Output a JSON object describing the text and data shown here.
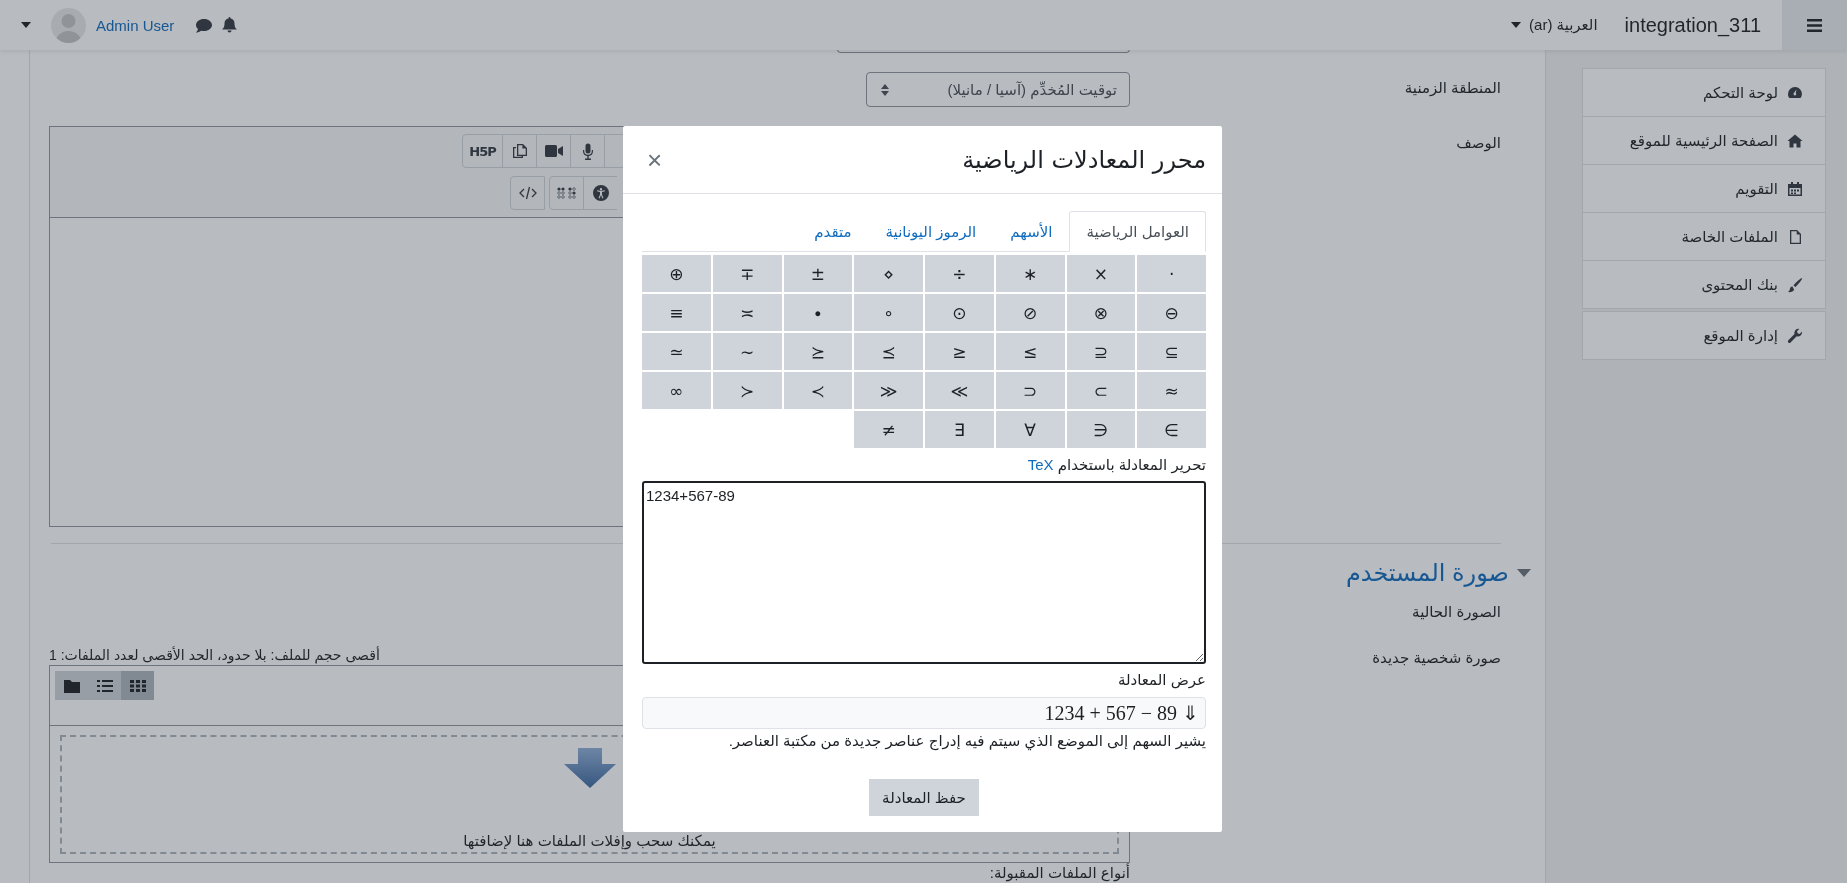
{
  "navbar": {
    "user_name": "Admin User",
    "language": "العربية (ar)",
    "site_name": "integration_311"
  },
  "sidebar": {
    "groups": [
      {
        "items": [
          {
            "label": "لوحة التحكم"
          },
          {
            "label": "الصفحة الرئيسية للموقع"
          },
          {
            "label": "التقويم"
          },
          {
            "label": "الملفات الخاصة"
          },
          {
            "label": "بنك المحتوى"
          }
        ]
      },
      {
        "items": [
          {
            "label": "إدارة الموقع"
          }
        ]
      }
    ]
  },
  "form": {
    "timezone": {
      "label": "المنطقة الزمنية",
      "value": "توقيت المُخدِّم (آسيا / مانيلا)"
    },
    "description": {
      "label": "الوصف",
      "h5p_button": "H5P"
    },
    "user_picture": {
      "heading": "صورة المستخدم",
      "expanded": true,
      "current_label": "الصورة الحالية",
      "new_label": "صورة شخصية جديدة",
      "file_limits": "أقصى حجم للملف: بلا حدود، الحد الأقصى لعدد الملفات: 1",
      "views": [
        {
          "kind": "folder",
          "selected": false
        },
        {
          "kind": "list",
          "selected": false
        },
        {
          "kind": "grid",
          "selected": true
        }
      ],
      "dropzone_text": "يمكنك سحب وإفلات الملفات هنا لإضافتها",
      "accepted_types_label": "أنواع الملفات المقبولة:"
    }
  },
  "dialog": {
    "title": "محرر المعادلات الرياضية",
    "close": "×",
    "tabs": [
      {
        "label": "العوامل الرياضية",
        "selected": true
      },
      {
        "label": "الأسهم",
        "selected": false
      },
      {
        "label": "الرموز اليونانية",
        "selected": false
      },
      {
        "label": "متقدم",
        "selected": false
      }
    ],
    "symbols": [
      "·",
      "×",
      "∗",
      "÷",
      "⋄",
      "±",
      "∓",
      "⊕",
      "⊖",
      "⊗",
      "⊘",
      "⊙",
      "∘",
      "∙",
      "≍",
      "≡",
      "⊆",
      "⊇",
      "≤",
      "≥",
      "⪯",
      "⪰",
      "∼",
      "≃",
      "≈",
      "⊂",
      "⊃",
      "≪",
      "≫",
      "≺",
      "≻",
      "∞",
      "∈",
      "∋",
      "∀",
      "∃",
      "≠"
    ],
    "tex_label": "تحرير المعادلة باستخدام",
    "tex_link": "TeX",
    "tex_value": "1234+567-89",
    "preview_label": "عرض المعادلة",
    "preview": "1234 + 567 − 89 ⇓",
    "help": "يشير السهم إلى الموضع الذي سيتم فيه إدراج عناصر جديدة من مكتبة العناصر.",
    "save_button": "حفظ المعادلة"
  }
}
